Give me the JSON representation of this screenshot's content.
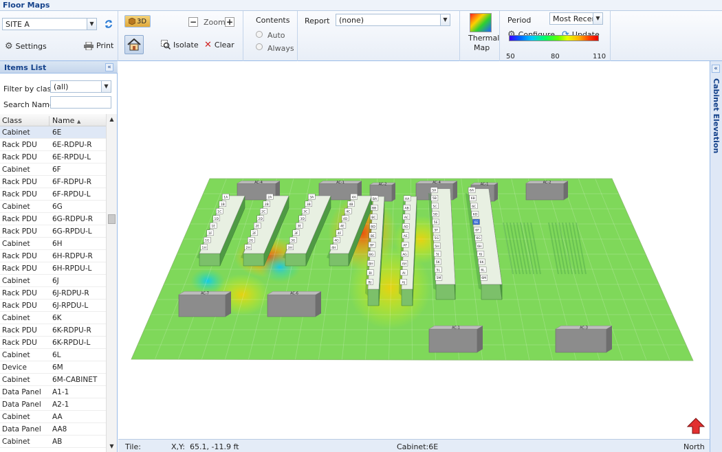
{
  "app": {
    "title": "Floor Maps"
  },
  "toolbar": {
    "site": "SITE A",
    "settings_label": "Settings",
    "print_label": "Print",
    "view3d_label": "3D",
    "zoom_label": "Zoom",
    "isolate_label": "Isolate",
    "clear_label": "Clear",
    "contents_label": "Contents",
    "auto_label": "Auto",
    "always_label": "Always",
    "report_label": "Report",
    "report_value": "(none)",
    "thermal_label_1": "Thermal",
    "thermal_label_2": "Map",
    "period_label": "Period",
    "period_value": "Most Recent",
    "configure_label": "Configure",
    "update_label": "Update",
    "scale_min": "50",
    "scale_mid": "80",
    "scale_max": "110"
  },
  "items_list": {
    "title": "Items List",
    "filter_label": "Filter by class",
    "filter_value": "(all)",
    "search_label": "Search Name",
    "col_class": "Class",
    "col_name": "Name",
    "rows": [
      {
        "cls": "Cabinet",
        "name": "6E"
      },
      {
        "cls": "Rack PDU",
        "name": "6E-RDPU-R"
      },
      {
        "cls": "Rack PDU",
        "name": "6E-RPDU-L"
      },
      {
        "cls": "Cabinet",
        "name": "6F"
      },
      {
        "cls": "Rack PDU",
        "name": "6F-RDPU-R"
      },
      {
        "cls": "Rack PDU",
        "name": "6F-RPDU-L"
      },
      {
        "cls": "Cabinet",
        "name": "6G"
      },
      {
        "cls": "Rack PDU",
        "name": "6G-RDPU-R"
      },
      {
        "cls": "Rack PDU",
        "name": "6G-RPDU-L"
      },
      {
        "cls": "Cabinet",
        "name": "6H"
      },
      {
        "cls": "Rack PDU",
        "name": "6H-RDPU-R"
      },
      {
        "cls": "Rack PDU",
        "name": "6H-RPDU-L"
      },
      {
        "cls": "Cabinet",
        "name": "6J"
      },
      {
        "cls": "Rack PDU",
        "name": "6J-RDPU-R"
      },
      {
        "cls": "Rack PDU",
        "name": "6J-RPDU-L"
      },
      {
        "cls": "Cabinet",
        "name": "6K"
      },
      {
        "cls": "Rack PDU",
        "name": "6K-RDPU-R"
      },
      {
        "cls": "Rack PDU",
        "name": "6K-RPDU-L"
      },
      {
        "cls": "Cabinet",
        "name": "6L"
      },
      {
        "cls": "Device",
        "name": "6M"
      },
      {
        "cls": "Cabinet",
        "name": "6M-CABINET"
      },
      {
        "cls": "Data Panel",
        "name": "A1-1"
      },
      {
        "cls": "Data Panel",
        "name": "A2-1"
      },
      {
        "cls": "Cabinet",
        "name": "AA"
      },
      {
        "cls": "Data Panel",
        "name": "AA8"
      },
      {
        "cls": "Cabinet",
        "name": "AB"
      }
    ]
  },
  "map": {
    "ac_units": [
      "AC-4",
      "AC-1",
      "AC-2",
      "AC-4",
      "AC-1",
      "AC-2",
      "AC-7",
      "AC-6",
      "AC-1",
      "AC-3"
    ],
    "rows": [
      {
        "labels": [
          "1A",
          "1B",
          "1C",
          "1D",
          "1E",
          "1F",
          "1G",
          "1H"
        ]
      },
      {
        "labels": [
          "2A",
          "2B",
          "2C",
          "2D",
          "2E",
          "2F",
          "2G",
          "2H"
        ]
      },
      {
        "labels": [
          "3A",
          "3B",
          "3C",
          "3D",
          "3E",
          "3F",
          "3G",
          "3H"
        ]
      },
      {
        "labels": [
          "4A",
          "4B",
          "4C",
          "4D",
          "4E",
          "4F",
          "4G",
          "4H"
        ]
      },
      {
        "labels": [
          "BA",
          "BB",
          "BC",
          "BD",
          "BE",
          "BF",
          "BG",
          "BH",
          "BI",
          "BJ"
        ]
      },
      {
        "labels": [
          "AA",
          "AB",
          "AC",
          "AD",
          "AE",
          "AF",
          "AG",
          "AH",
          "AI",
          "AJ"
        ]
      },
      {
        "labels": [
          "5A",
          "5B",
          "5C",
          "5D",
          "5E",
          "5F",
          "5G",
          "5H",
          "5J",
          "5K",
          "5L",
          "5M"
        ]
      },
      {
        "labels": [
          "6A",
          "6B",
          "6C",
          "6D",
          "6E",
          "6F",
          "6G",
          "6H",
          "6J",
          "6K",
          "6L",
          "6M"
        ]
      }
    ],
    "selected_cabinet": "6E"
  },
  "status": {
    "tile_label": "Tile:",
    "xy_label": "X,Y:",
    "xy_value": "65.1, -11.9 ft",
    "cabinet_label": "Cabinet:",
    "cabinet_value": "6E",
    "north_label": "North"
  },
  "right_panel": {
    "title": "Cabinet Elevation"
  }
}
